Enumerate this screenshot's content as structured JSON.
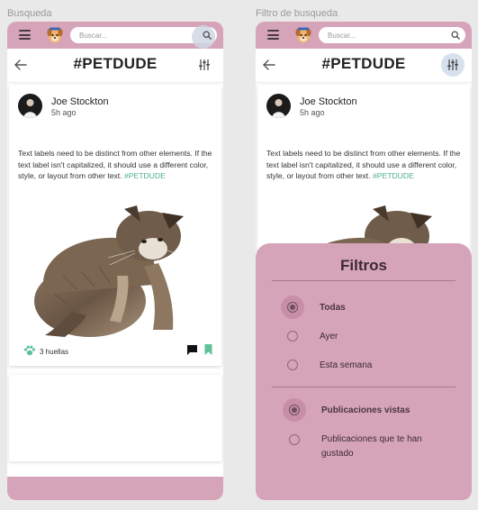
{
  "frames": {
    "left_label": "Busqueda",
    "right_label": "Filtro de busqueda"
  },
  "topbar": {
    "search_placeholder": "Buscar...",
    "icons": [
      "menu-icon",
      "dog-logo-icon",
      "search-icon"
    ]
  },
  "header": {
    "title": "#PETDUDE",
    "icons": [
      "back-arrow-icon",
      "sliders-icon"
    ]
  },
  "post": {
    "user_name": "Joe Stockton",
    "time": "5h ago",
    "text": "Text labels need to be distinct from other elements. If the text label isn't capitalized, it should use a different color, style, or layout from other text.",
    "hashtag": "#PETDUDE",
    "likes": "3 huellas",
    "icons": [
      "paw-icon",
      "comment-icon",
      "bookmark-icon"
    ]
  },
  "filters": {
    "title": "Filtros",
    "group_time": [
      {
        "label": "Todas",
        "selected": true
      },
      {
        "label": "Ayer",
        "selected": false
      },
      {
        "label": "Esta semana",
        "selected": false
      }
    ],
    "group_type": [
      {
        "label": "Publicaciones vistas",
        "selected": true
      },
      {
        "label": "Publicaciones que te han gustado",
        "selected": false
      }
    ]
  },
  "colors": {
    "brand_pink": "#d6a4b9",
    "hashtag_green": "#4fae8d",
    "highlight_blue": "#d7e1ee"
  }
}
